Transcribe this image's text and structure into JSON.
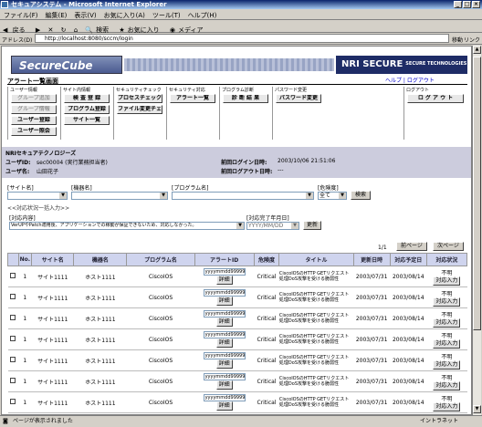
{
  "window": {
    "title": "セキュアシステム - Microsoft Internet Explorer"
  },
  "menu": [
    "ファイル(F)",
    "編集(E)",
    "表示(V)",
    "お気に入り(A)",
    "ツール(T)",
    "ヘルプ(H)"
  ],
  "toolbar": {
    "back": "戻る",
    "search": "検索",
    "favorites": "お気に入り",
    "media": "メディア"
  },
  "address": {
    "label": "アドレス(D)",
    "url": "http://localhost:8080/sccm/login",
    "go": "移動",
    "links": "リンク"
  },
  "logo": {
    "left": "SecureCube",
    "right": "NRI SECURE",
    "right_sub": "SECURE TECHNOLOGIES"
  },
  "nav": {
    "title": "アラート一覧画面",
    "help": "ヘルプ | ログアウト"
  },
  "groups": [
    {
      "label": "ユーザー情報",
      "buttons": [
        "グループ追加",
        "グループ情報",
        "ユーザー登録",
        "ユーザー照会"
      ]
    },
    {
      "label": "サイト内情報",
      "buttons": [
        "検 査 登 録",
        "プログラム登録",
        "サイト一覧"
      ]
    },
    {
      "label": "セキュリティチェック",
      "buttons": [
        "プロセスチェック",
        "ファイル変更チェック"
      ]
    },
    {
      "label": "セキュリティ対応",
      "buttons": [
        "アラート一覧"
      ]
    },
    {
      "label": "プログラム診断",
      "buttons": [
        "診 断 結 果"
      ]
    },
    {
      "label": "パスワード変更",
      "buttons": [
        "パスワード変更"
      ]
    },
    {
      "label": "ログアウト",
      "buttons": [
        "ロ グ ア ウ ト"
      ]
    }
  ],
  "info": {
    "company": "NRIセキュアテクノロジーズ",
    "uid_label": "ユーザID:",
    "uid": "sec00004 (実行業務担当者)",
    "uname_label": "ユーザ名:",
    "uname": "山田花子",
    "last_login_label": "前回ログイン日時:",
    "last_login": "2003/10/06 21:51:06",
    "last_logout_label": "前回ログアウト日時:",
    "last_logout": "---"
  },
  "filters": {
    "site": "[サイト名]",
    "host": "[機器名]",
    "program": "[プログラム名]",
    "danger": "[危険度]",
    "danger_value": "全て",
    "search": "検索",
    "status_input": "<<対応状況一括入力>>",
    "content_label": "[対応内容]",
    "content_value": "VerUPやPatch適用後、アプリケーションでの稼動が保証できないため、対応しなかった。",
    "date_label": "[対応完了年月日]",
    "date_value": "YYYY/MM/DD",
    "update": "更新"
  },
  "pager": {
    "page": "1/1",
    "prev": "前ページ",
    "next": "次ページ"
  },
  "table": {
    "headers": [
      "No.",
      "サイト名",
      "機器名",
      "プログラム名",
      "アラートID",
      "危険度",
      "タイトル",
      "更新日時",
      "対応予定日",
      "対応状況"
    ],
    "rows": [
      {
        "no": "1",
        "site": "サイト1111",
        "host": "ホスト1111",
        "prog": "CiscoIOS",
        "alert": "yyyymmdd99999",
        "detail": "詳細",
        "danger": "Critical",
        "title": "CiscoIOSのHTTP GETリクエスト処理DoS攻撃を受ける脆弱性",
        "upd": "2003/07/31",
        "plan": "2003/08/14",
        "status": "不明",
        "input": "対応入力"
      },
      {
        "no": "1",
        "site": "サイト1111",
        "host": "ホスト1111",
        "prog": "CiscoIOS",
        "alert": "yyyymmdd99999",
        "detail": "詳細",
        "danger": "Critical",
        "title": "CiscoIOSのHTTP GETリクエスト処理DoS攻撃を受ける脆弱性",
        "upd": "2003/07/31",
        "plan": "2003/08/14",
        "status": "不明",
        "input": "対応入力"
      },
      {
        "no": "1",
        "site": "サイト1111",
        "host": "ホスト1111",
        "prog": "CiscoIOS",
        "alert": "yyyymmdd99999",
        "detail": "詳細",
        "danger": "Critical",
        "title": "CiscoIOSのHTTP GETリクエスト処理DoS攻撃を受ける脆弱性",
        "upd": "2003/07/31",
        "plan": "2003/08/14",
        "status": "不明",
        "input": "対応入力"
      },
      {
        "no": "1",
        "site": "サイト1111",
        "host": "ホスト1111",
        "prog": "CiscoIOS",
        "alert": "yyyymmdd99999",
        "detail": "詳細",
        "danger": "Critical",
        "title": "CiscoIOSのHTTP GETリクエスト処理DoS攻撃を受ける脆弱性",
        "upd": "2003/07/31",
        "plan": "2003/08/14",
        "status": "不明",
        "input": "対応入力"
      },
      {
        "no": "1",
        "site": "サイト1111",
        "host": "ホスト1111",
        "prog": "CiscoIOS",
        "alert": "yyyymmdd99999",
        "detail": "詳細",
        "danger": "Critical",
        "title": "CiscoIOSのHTTP GETリクエスト処理DoS攻撃を受ける脆弱性",
        "upd": "2003/07/31",
        "plan": "2003/08/14",
        "status": "不明",
        "input": "対応入力"
      },
      {
        "no": "1",
        "site": "サイト1111",
        "host": "ホスト1111",
        "prog": "CiscoIOS",
        "alert": "yyyymmdd99999",
        "detail": "詳細",
        "danger": "Critical",
        "title": "CiscoIOSのHTTP GETリクエスト処理DoS攻撃を受ける脆弱性",
        "upd": "2003/07/31",
        "plan": "2003/08/14",
        "status": "不明",
        "input": "対応入力"
      },
      {
        "no": "1",
        "site": "サイト1111",
        "host": "ホスト1111",
        "prog": "CiscoIOS",
        "alert": "yyyymmdd99999",
        "detail": "詳細",
        "danger": "Critical",
        "title": "CiscoIOSのHTTP GETリクエスト処理DoS攻撃を受ける脆弱性",
        "upd": "2003/07/31",
        "plan": "2003/08/14",
        "status": "不明",
        "input": "対応入力"
      }
    ]
  },
  "status": {
    "text": "ページが表示されました",
    "zone": "イントラネット"
  }
}
